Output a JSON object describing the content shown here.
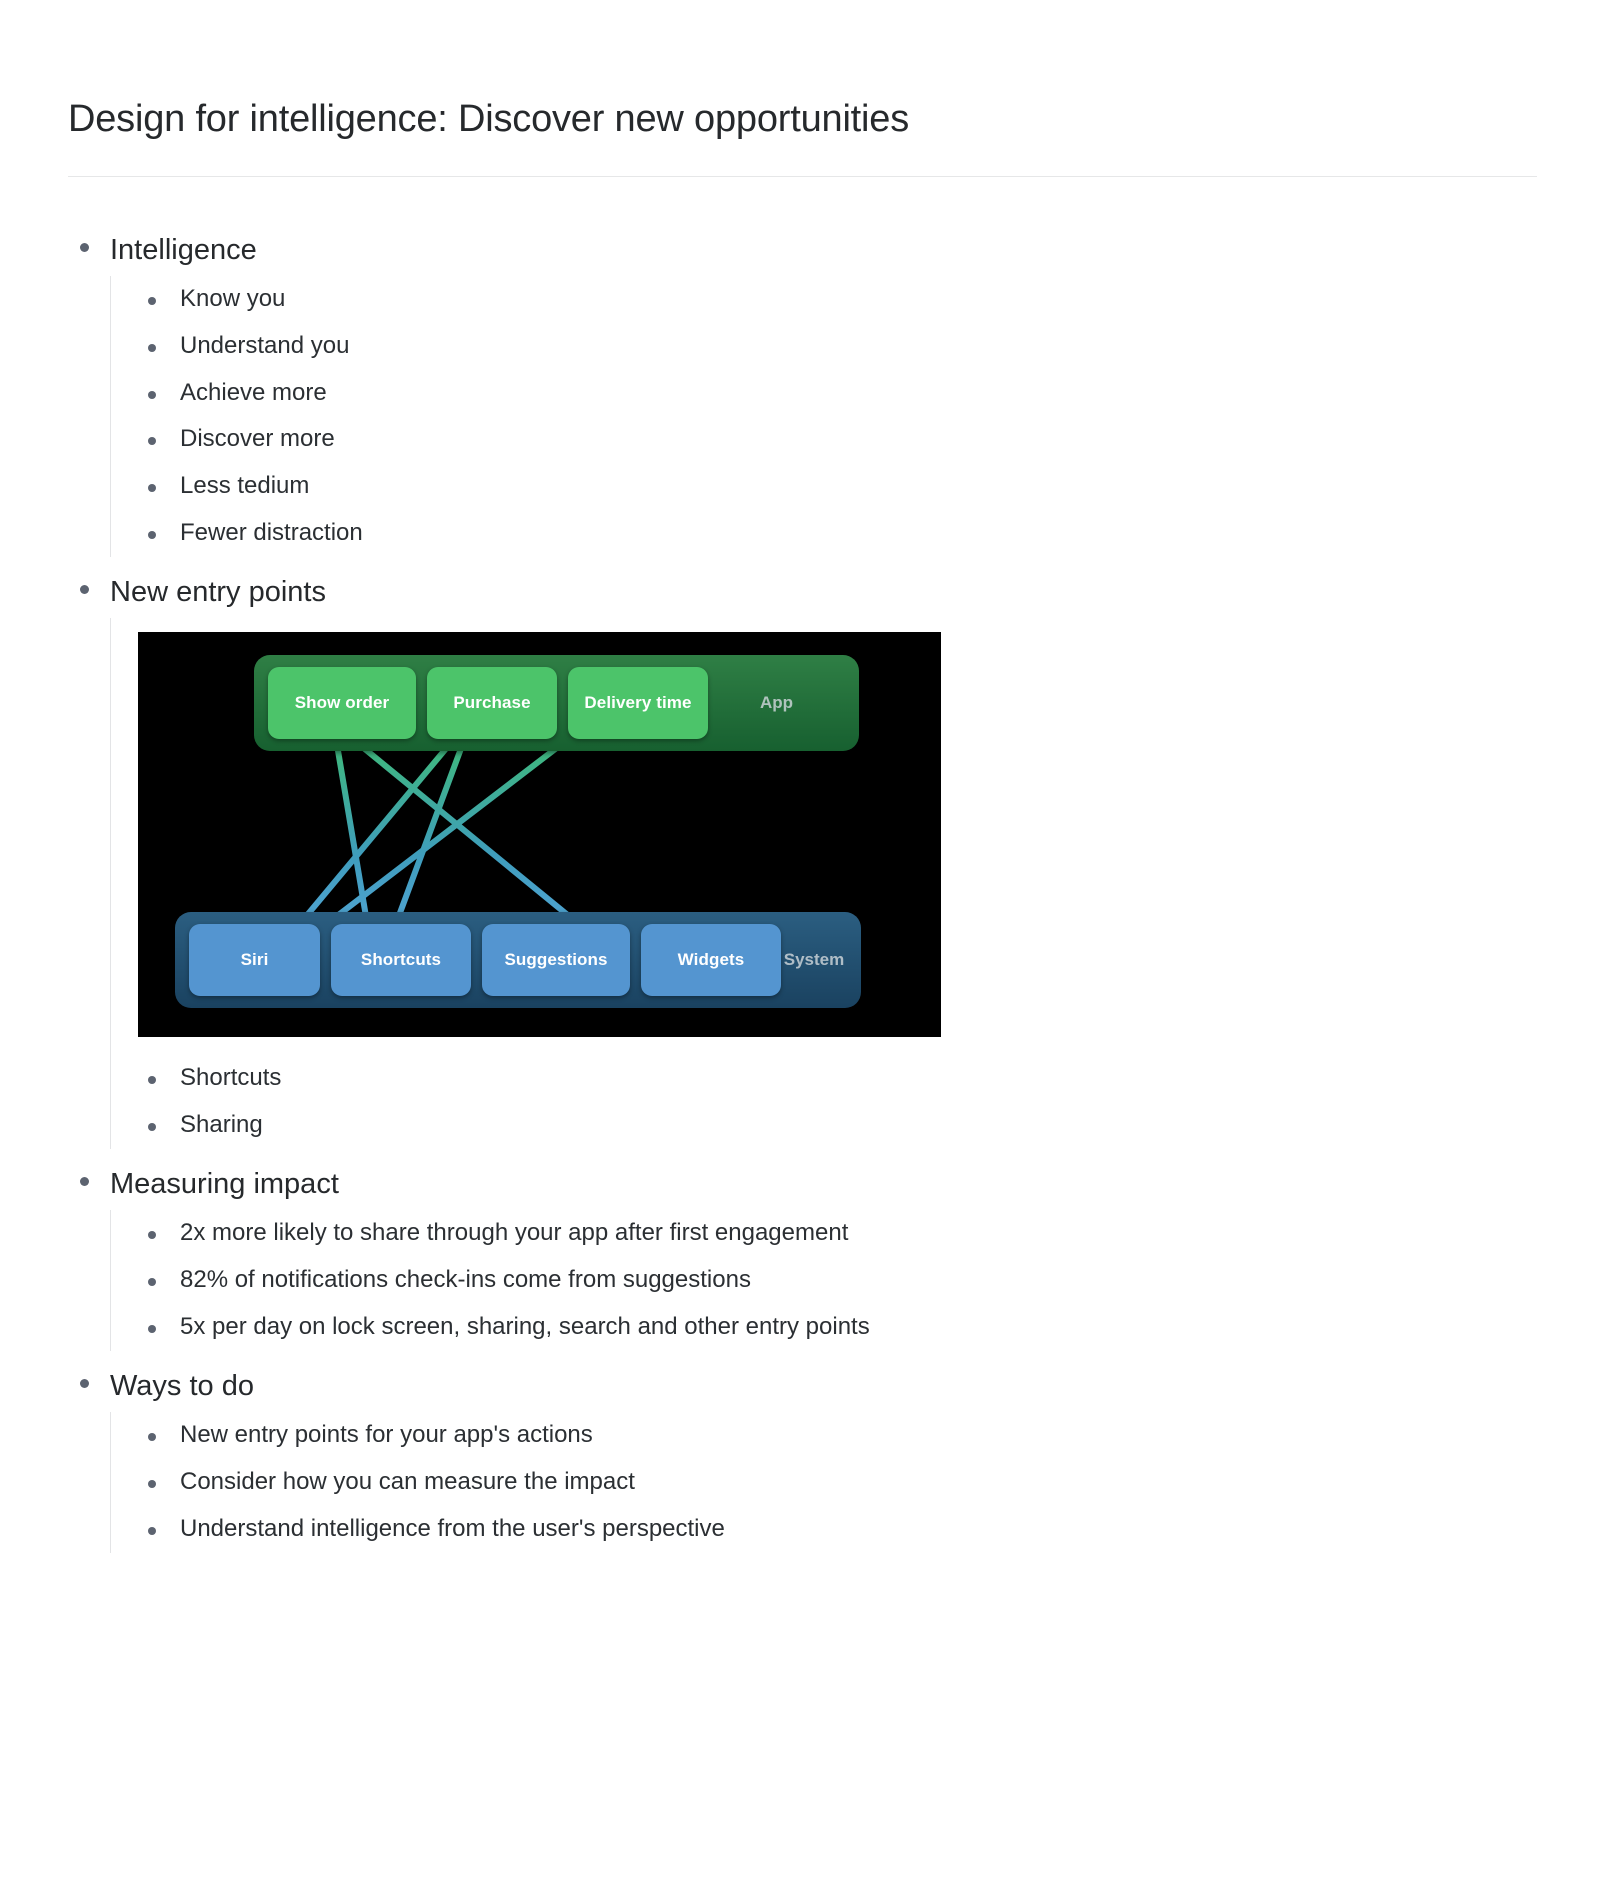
{
  "document": {
    "title": "Design for intelligence: Discover new opportunities"
  },
  "outline": [
    {
      "label": "Intelligence",
      "children": [
        {
          "label": "Know you"
        },
        {
          "label": "Understand you"
        },
        {
          "label": "Achieve more"
        },
        {
          "label": "Discover more"
        },
        {
          "label": "Less tedium"
        },
        {
          "label": "Fewer distraction"
        }
      ]
    },
    {
      "label": "New entry points",
      "children": [
        {
          "label": "Shortcuts"
        },
        {
          "label": "Sharing"
        }
      ]
    },
    {
      "label": "Measuring impact",
      "children": [
        {
          "label": "2x more likely to share through your app after first engagement"
        },
        {
          "label": "82% of notifications check-ins come from suggestions"
        },
        {
          "label": "5x per day on lock screen, sharing, search and other entry points"
        }
      ]
    },
    {
      "label": "Ways to do",
      "children": [
        {
          "label": "New entry points for your app's actions"
        },
        {
          "label": "Consider how you can measure the impact"
        },
        {
          "label": "Understand intelligence from the user's perspective"
        }
      ]
    }
  ],
  "diagram": {
    "background": "#000000",
    "app_layer": {
      "band_label": "App",
      "band_color": "#1e6b38",
      "chip_color": "#4cc46a",
      "chips": [
        {
          "label": "Show order"
        },
        {
          "label": "Purchase"
        },
        {
          "label": "Delivery time"
        }
      ]
    },
    "system_layer": {
      "band_label": "System",
      "band_color": "#1f4f70",
      "chip_color": "#5495d0",
      "chips": [
        {
          "label": "Siri"
        },
        {
          "label": "Shortcuts"
        },
        {
          "label": "Suggestions"
        },
        {
          "label": "Widgets"
        }
      ]
    },
    "connections": [
      {
        "from": "Show order",
        "to": "Shortcuts"
      },
      {
        "from": "Show order",
        "to": "Widgets"
      },
      {
        "from": "Purchase",
        "to": "Siri"
      },
      {
        "from": "Purchase",
        "to": "Shortcuts"
      },
      {
        "from": "Delivery time",
        "to": "Siri"
      },
      {
        "from": "Delivery time",
        "to": "Suggestions"
      }
    ]
  },
  "colors": {
    "title_text": "#26292c",
    "body_text": "#2b2f33",
    "bullet": "#5c6370",
    "rule": "#e6e7e8",
    "guide_rail": "#e3e4e6",
    "accent_green": "#4cc46a",
    "accent_blue": "#5495d0"
  }
}
